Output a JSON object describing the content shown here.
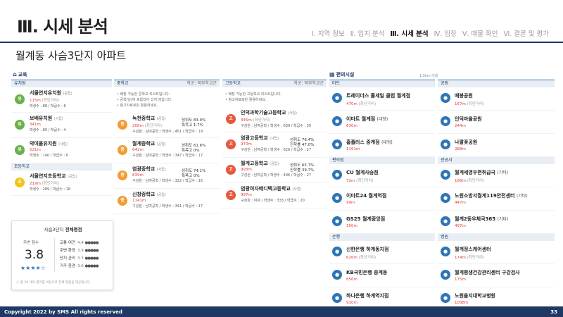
{
  "header": {
    "title": "Ⅲ. 시세 분석",
    "nav": [
      "Ⅰ. 지역 정보",
      "Ⅱ. 입지 분석",
      "Ⅲ. 시세 분석",
      "Ⅳ. 임장",
      "Ⅴ. 매물 확인",
      "Ⅵ. 결론 및 평가"
    ],
    "active_nav": "Ⅲ. 시세 분석"
  },
  "apartment_name": "월계동 사슴3단지 아파트",
  "education": {
    "title": "교육",
    "kindergarten_label": "유치원",
    "elementary_label": "초등학교",
    "kindergartens": [
      {
        "badge": "유",
        "name": "서울연지유치원",
        "type": "(공립)",
        "dist": "115m",
        "pri": "(최단거리)",
        "info": "학생수 : 88 / 학급수 : 6"
      },
      {
        "badge": "유",
        "name": "보배유치원",
        "type": "(사립)",
        "dist": "341m",
        "pri": "",
        "info": "학생수 : 80 / 학급수 : 4"
      },
      {
        "badge": "유",
        "name": "약여울유치원",
        "type": "(사립)",
        "dist": "521m",
        "pri": "",
        "info": "학생수 : 140 / 학급수 : 6"
      }
    ],
    "elementary": [
      {
        "badge": "초",
        "name": "서울연지초등학교",
        "type": "(공립)",
        "dist": "219m",
        "pri": "(최단거리)",
        "info": "학생수 : 289 / 학급수 : 18"
      }
    ],
    "middle": {
      "label": "중학교",
      "district": "학군: 북부학교군",
      "notes": [
        "• 배정 가능한 중학교 리스트입니다.",
        "• 공학/남/여 포함되어 있지 않습니다.",
        "• 참고자료로만 활용하세요."
      ],
      "items": [
        {
          "badge": "중",
          "name": "녹천중학교",
          "type": "(공립)",
          "dist": "208m",
          "pri": "(최단거리)",
          "info": "구성원 : 남여공학 / 학생수 : 451 / 학급수 : 19",
          "rate1": "성취도 83.0%",
          "rate2": "특목고 1.7%"
        },
        {
          "badge": "중",
          "name": "월계중학교",
          "type": "(공립)",
          "dist": "642m",
          "pri": "",
          "info": "구성원 : 남여공학 / 학생수 : 347 / 학급수 : 17",
          "rate1": "성취도 61.6%",
          "rate2": "특목고 0%"
        },
        {
          "badge": "중",
          "name": "염광중학교",
          "type": "(사립)",
          "dist": "839m",
          "pri": "",
          "info": "구성원 : 남여공학 / 학생수 : 322 / 학급수 : 16",
          "rate1": "성취도 74.1%",
          "rate2": "특목고 0%"
        },
        {
          "badge": "중",
          "name": "신창중학교",
          "type": "(공립)",
          "dist": "1141m",
          "pri": "",
          "info": "구성원 : 남여공학 / 학생수 : 341 / 학급수 : 17",
          "rate1": "",
          "rate2": ""
        }
      ]
    },
    "high": {
      "label": "고등학교",
      "district": "학군: 북부학교군",
      "notes": [
        "• 배정 가능한 고등학교 리스트입니다.",
        "• 참고자료로만 활용하세요."
      ],
      "items": [
        {
          "badge": "고",
          "name": "인덕과학기술고등학교",
          "type": "(사립)",
          "dist": "345m",
          "pri": "(최단거리)",
          "info": "구성원 : 남여공학 / 학생수 : 630 / 학급수 : 30",
          "rate1": "",
          "rate2": ""
        },
        {
          "badge": "고",
          "name": "염광고등학교",
          "type": "(사립)",
          "dist": "970m",
          "pri": "",
          "info": "구성원 : 남여공학 / 학생수 : 626 / 학급수 : 27",
          "rate1": "성취도 76.4%",
          "rate2": "진학률 47.0%"
        },
        {
          "badge": "고",
          "name": "월계고등학교",
          "type": "(공립)",
          "dist": "993m",
          "pri": "",
          "info": "구성원 : 남여공학 / 학생수 : 496 / 학급수 : 27",
          "rate1": "성취도 65.7%",
          "rate2": "진학률 39.7%"
        },
        {
          "badge": "고",
          "name": "염광여자메디텍고등학교",
          "type": "(사립)",
          "dist": "997m",
          "pri": "",
          "info": "구성원 : 여자 / 학생수 : 333 / 학급수 : 20",
          "rate1": "",
          "rate2": ""
        }
      ]
    }
  },
  "score": {
    "title_prefix": "사슴3단지 ",
    "title_bold": "전체평점",
    "label": "주변 점수",
    "value": "3.8",
    "stars": "★★★★☆",
    "categories": [
      {
        "name": "교통 여건",
        "value": "4.4",
        "stars": "●●●●●"
      },
      {
        "name": "주변 환경",
        "value": "3.9",
        "stars": "●●●●●"
      },
      {
        "name": "단지 관리",
        "value": "3.3",
        "stars": "●●●●●"
      },
      {
        "name": "거주 환경",
        "value": "3.6",
        "stars": "●●●●●"
      }
    ],
    "footnote": "ⓘ 총 56 개의 평가를 바탕으로 전체 평점을 제공합니다."
  },
  "amenities": {
    "title": "편의시설",
    "radius": "1.5km 이내",
    "mart": {
      "label": "마트",
      "items": [
        {
          "name": "트레이더스 홀세일 클럽 월계점",
          "sub": "",
          "dist": "470m",
          "pri": "(최단거리)"
        },
        {
          "name": "이마트 월계점",
          "sub": "(대형)",
          "dist": "630m",
          "pri": ""
        },
        {
          "name": "홈플러스 중계점",
          "sub": "(대형)",
          "dist": "1191m",
          "pri": ""
        }
      ]
    },
    "convenience": {
      "label": "편의점",
      "items": [
        {
          "name": "CU 월계사슴점",
          "sub": "",
          "dist": "72m",
          "pri": "(최단거리)"
        },
        {
          "name": "이마트24 월계역점",
          "sub": "",
          "dist": "99m",
          "pri": ""
        },
        {
          "name": "GS25 월계중앙점",
          "sub": "",
          "dist": "150m",
          "pri": ""
        }
      ]
    },
    "bank": {
      "label": "은행",
      "items": [
        {
          "name": "신한은행 하계동지점",
          "sub": "",
          "dist": "626m",
          "pri": "(최단거리)"
        },
        {
          "name": "KB국민은행 중계동",
          "sub": "",
          "dist": "856m",
          "pri": ""
        },
        {
          "name": "하나은행 하계역지점",
          "sub": "",
          "dist": "910m",
          "pri": ""
        }
      ]
    },
    "park": {
      "label": "공원",
      "items": [
        {
          "name": "매봉공원",
          "sub": "",
          "dist": "167m",
          "pri": "(최단거리)"
        },
        {
          "name": "인덕마을공원",
          "sub": "",
          "dist": "244m",
          "pri": ""
        },
        {
          "name": "나팔꽃공원",
          "sub": "",
          "dist": "288m",
          "pri": ""
        }
      ]
    },
    "office": {
      "label": "관공서",
      "items": [
        {
          "name": "월계세영우편취급국",
          "sub": "(기타)",
          "dist": "168m",
          "pri": "(최단거리)"
        },
        {
          "name": "노원소방서월계119안전센터",
          "sub": "(기타)",
          "dist": "447m",
          "pri": ""
        },
        {
          "name": "월계2동우체국365",
          "sub": "(기타)",
          "dist": "497m",
          "pri": ""
        }
      ]
    },
    "hospital": {
      "label": "병원",
      "items": [
        {
          "name": "월계정스케어센터",
          "sub": "",
          "dist": "174m",
          "pri": "(최단거리)"
        },
        {
          "name": "월계평생건강관리센터 구강검사",
          "sub": "",
          "dist": "175m",
          "pri": ""
        },
        {
          "name": "노원을지대학교병원",
          "sub": "",
          "dist": "1038m",
          "pri": ""
        }
      ]
    }
  },
  "footer": {
    "copyright": "Copyright 2022 by SMS All rights reserved",
    "page": "33"
  },
  "colors": {
    "navy": "#1f3864",
    "accent": "#2e75b6",
    "red": "#e53935"
  }
}
